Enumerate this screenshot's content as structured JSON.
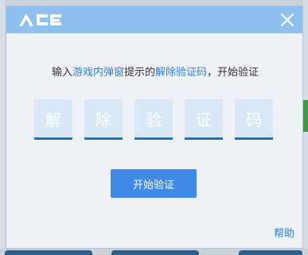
{
  "dialog": {
    "logo_text": "ACE",
    "instruction": {
      "prefix": "输入",
      "highlight1": "游戏内弹窗",
      "middle": "提示的",
      "highlight2": "解除验证码",
      "suffix": "，开始验证"
    },
    "code_chars": [
      "解",
      "除",
      "验",
      "证",
      "码"
    ],
    "start_button_label": "开始验证",
    "help_link_label": "帮助"
  },
  "colors": {
    "header_bg": "#8ec1f0",
    "accent": "#2f7fd3",
    "button_bg": "#3f8ae6",
    "code_box_bg": "#d9e8f6"
  }
}
